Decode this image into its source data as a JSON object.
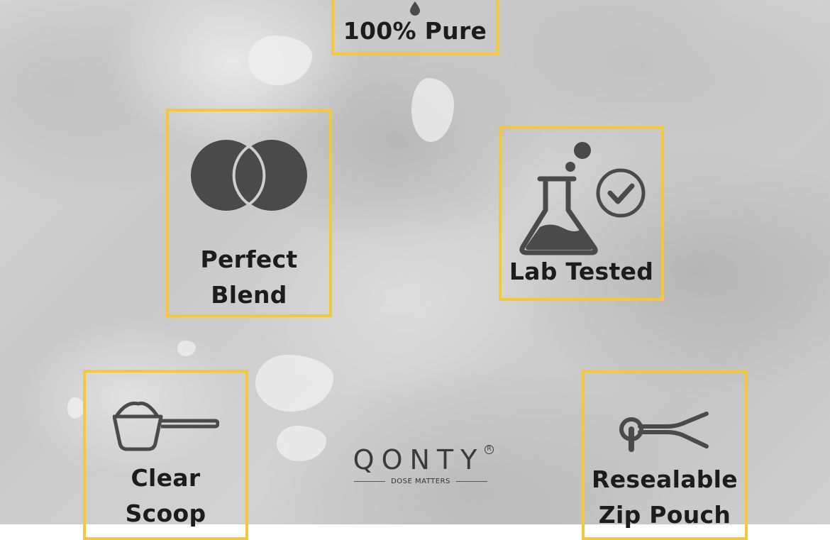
{
  "features": {
    "pure": {
      "label": "100% Pure",
      "icon": "drop-icon"
    },
    "blend": {
      "label": "Perfect\nBlend",
      "icon": "overlapping-circles-icon"
    },
    "lab": {
      "label": "Lab Tested",
      "icon": "flask-check-icon"
    },
    "scoop": {
      "label": "Clear\nScoop",
      "icon": "scoop-icon"
    },
    "pouch": {
      "label": "Resealable\nZip Pouch",
      "icon": "zip-slider-icon"
    }
  },
  "logo": {
    "brand": "QONTY",
    "registered": "R",
    "tagline": "DOSE MATTERS"
  },
  "colors": {
    "accent_border": "#f5c73a",
    "icon": "#4a4a4a",
    "text": "#1c1c1c"
  }
}
